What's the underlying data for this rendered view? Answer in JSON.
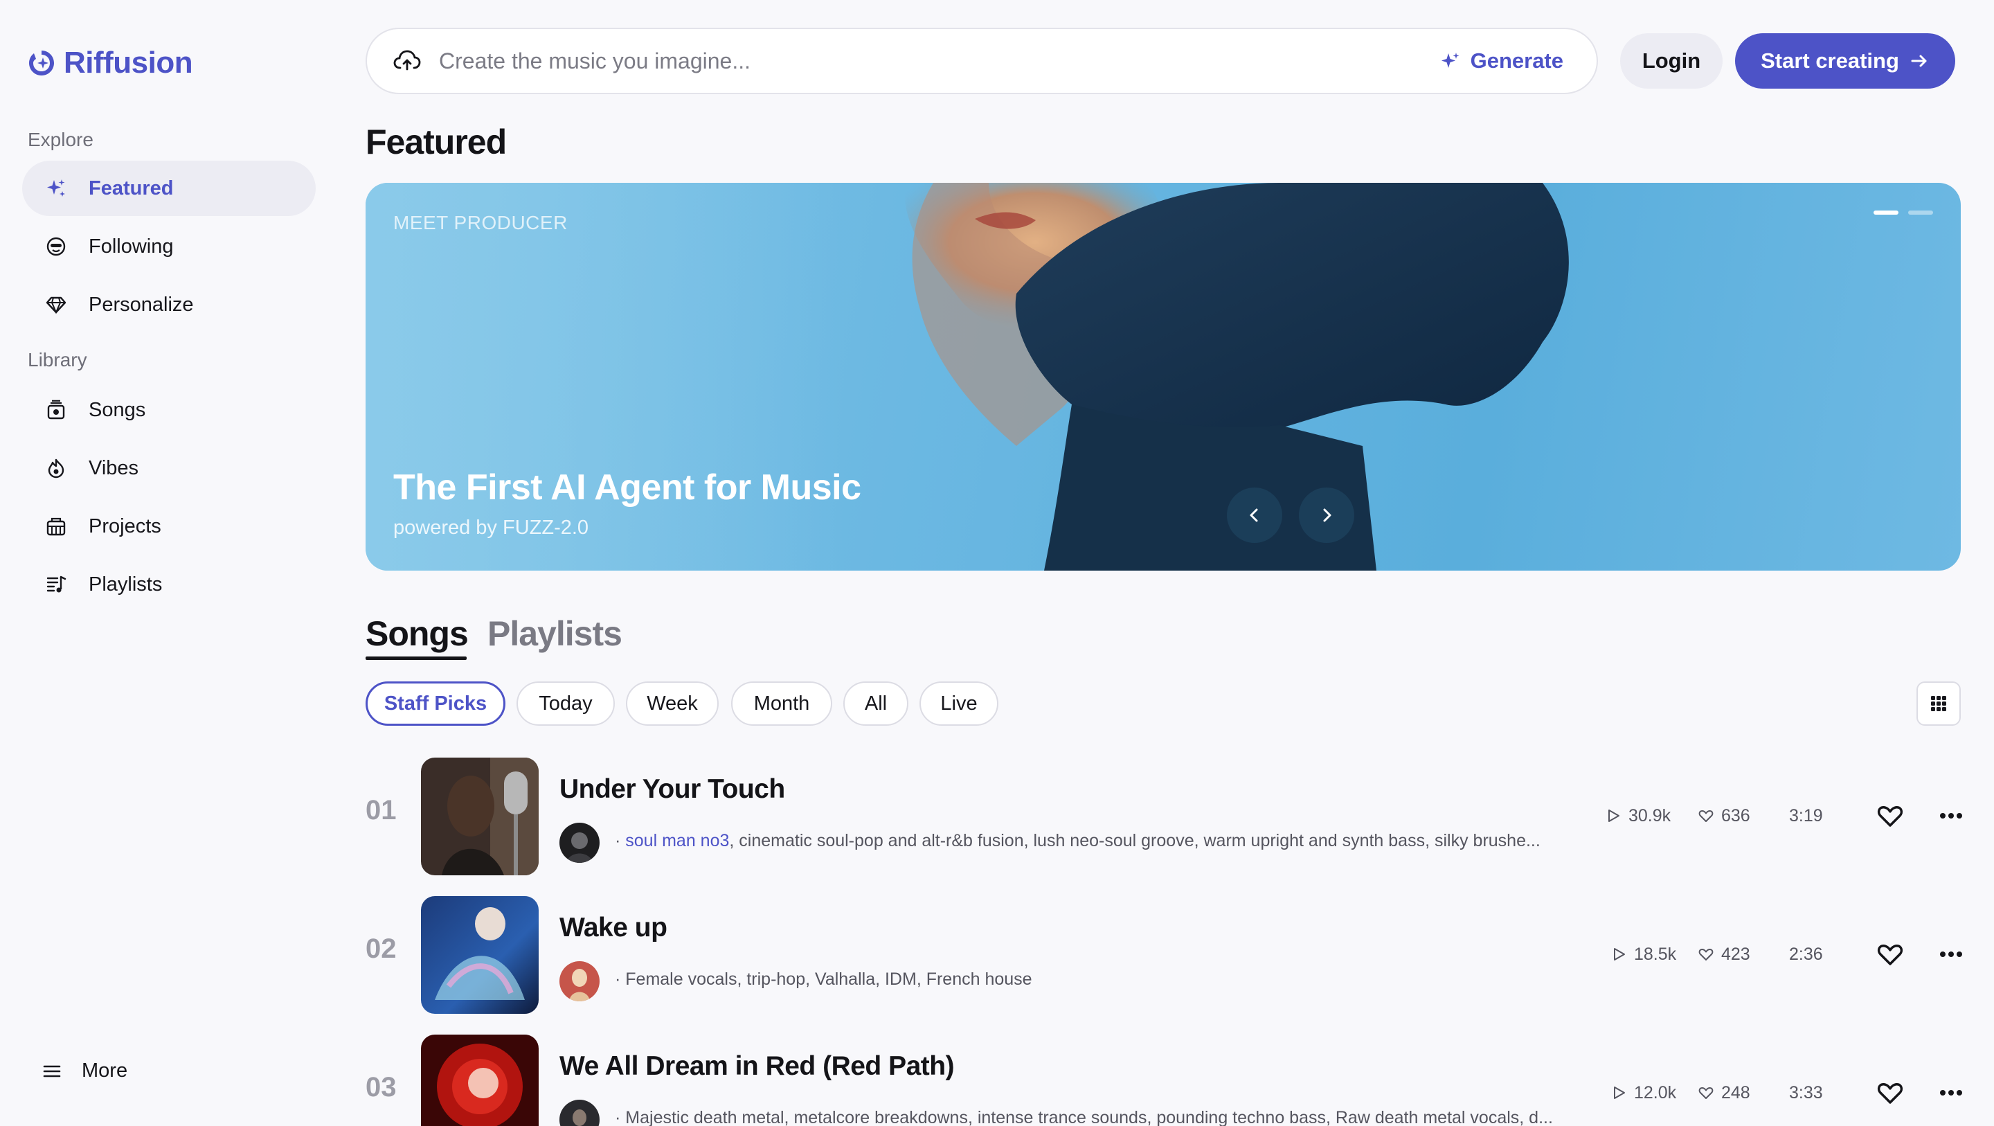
{
  "app": {
    "name": "Riffusion"
  },
  "sidebar": {
    "explore_label": "Explore",
    "library_label": "Library",
    "explore_items": [
      {
        "label": "Featured",
        "icon": "sparkle-icon",
        "active": true
      },
      {
        "label": "Following",
        "icon": "face-icon"
      },
      {
        "label": "Personalize",
        "icon": "diamond-icon"
      }
    ],
    "library_items": [
      {
        "label": "Songs",
        "icon": "songs-icon"
      },
      {
        "label": "Vibes",
        "icon": "flame-icon"
      },
      {
        "label": "Projects",
        "icon": "projects-icon"
      },
      {
        "label": "Playlists",
        "icon": "playlist-icon"
      }
    ],
    "more_label": "More"
  },
  "topbar": {
    "search_placeholder": "Create the music you imagine...",
    "generate_label": "Generate",
    "login_label": "Login",
    "start_label": "Start creating"
  },
  "featured": {
    "heading": "Featured",
    "hero": {
      "label": "MEET PRODUCER",
      "title": "The First AI Agent for Music",
      "subtitle": "powered by FUZZ-2.0",
      "slide_count": 2,
      "active_slide": 1
    }
  },
  "tabs": {
    "songs": "Songs",
    "playlists": "Playlists",
    "active": "Songs"
  },
  "filters": [
    "Staff Picks",
    "Today",
    "Week",
    "Month",
    "All",
    "Live"
  ],
  "active_filter": "Staff Picks",
  "songs": [
    {
      "rank": "01",
      "title": "Under Your Touch",
      "artist": "soul man no3",
      "description": ", cinematic soul-pop and alt-r&b fusion, lush neo-soul groove, warm upright and synth bass, silky brushe...",
      "plays": "30.9k",
      "likes": "636",
      "duration": "3:19"
    },
    {
      "rank": "02",
      "title": "Wake up",
      "artist": "",
      "description": "Female vocals, trip-hop, Valhalla, IDM, French house",
      "plays": "18.5k",
      "likes": "423",
      "duration": "2:36"
    },
    {
      "rank": "03",
      "title": "We All Dream in Red (Red Path)",
      "artist": "",
      "description": "Majestic death metal, metalcore breakdowns, intense trance sounds, pounding techno bass, Raw death metal vocals, d...",
      "plays": "12.0k",
      "likes": "248",
      "duration": "3:33"
    }
  ],
  "colors": {
    "accent": "#4d53c7",
    "background": "#f8f8fb",
    "hero_sky": "#6bb8e2"
  }
}
